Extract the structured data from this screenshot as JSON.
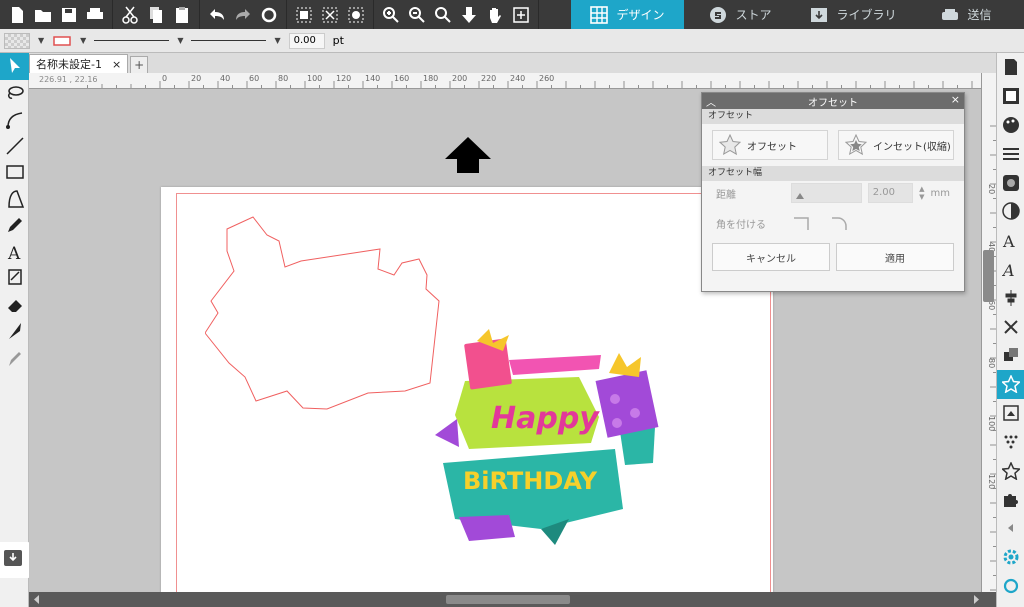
{
  "nav_tabs": [
    {
      "label": "デザイン",
      "icon": "grid-icon"
    },
    {
      "label": "ストア",
      "icon": "store-icon"
    },
    {
      "label": "ライブラリ",
      "icon": "library-icon"
    },
    {
      "label": "送信",
      "icon": "send-icon"
    }
  ],
  "props": {
    "line_width": "0.00",
    "unit": "pt"
  },
  "doc_tab": {
    "label": "名称未設定-1",
    "close": "×",
    "add": "+"
  },
  "ruler": {
    "h_labels": [
      "0",
      "20",
      "40",
      "60",
      "80",
      "100",
      "120",
      "140",
      "160",
      "180",
      "200",
      "220",
      "240",
      "260"
    ],
    "v_labels": [
      "20",
      "40",
      "60",
      "80",
      "100",
      "120"
    ],
    "coords": "226.91 , 22.16"
  },
  "offset_panel": {
    "title": "オフセット",
    "section1": "オフセット",
    "offset_btn": "オフセット",
    "inset_btn": "インセット(収縮)",
    "section2": "オフセット幅",
    "distance_label": "距離",
    "distance_value": "2.00",
    "distance_unit": "mm",
    "corner_label": "角を付ける",
    "cancel": "キャンセル",
    "apply": "適用"
  },
  "artwork": {
    "text1": "Happy",
    "text2": "BiRTHDAY"
  },
  "colors": {
    "accent": "#1ea6c9",
    "toolbar": "#3a3a3a",
    "cutline": "#f09090"
  }
}
